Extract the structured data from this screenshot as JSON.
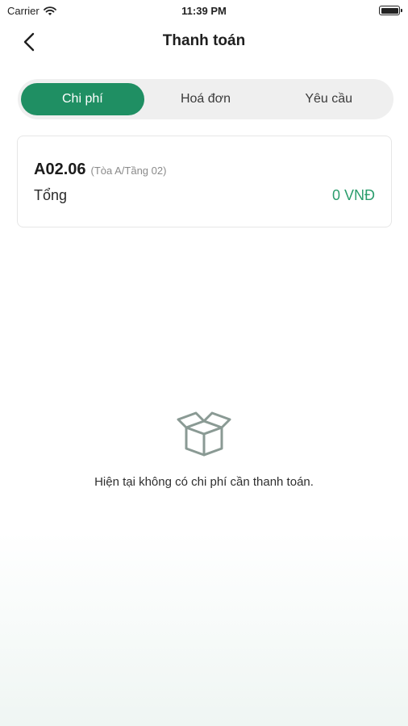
{
  "status_bar": {
    "carrier": "Carrier",
    "time": "11:39 PM"
  },
  "header": {
    "title": "Thanh toán"
  },
  "tabs": [
    {
      "label": "Chi phí",
      "active": true
    },
    {
      "label": "Hoá đơn",
      "active": false
    },
    {
      "label": "Yêu cầu",
      "active": false
    }
  ],
  "card": {
    "unit_code": "A02.06",
    "unit_location": "(Tòa A/Tầng 02)",
    "total_label": "Tổng",
    "total_value": "0 VNĐ"
  },
  "empty_state": {
    "icon": "open-box-icon",
    "message": "Hiện tại không có chi phí cần thanh toán."
  },
  "colors": {
    "accent": "#1f8f63",
    "amount": "#2b9d6d",
    "tab_background": "#efefef"
  }
}
